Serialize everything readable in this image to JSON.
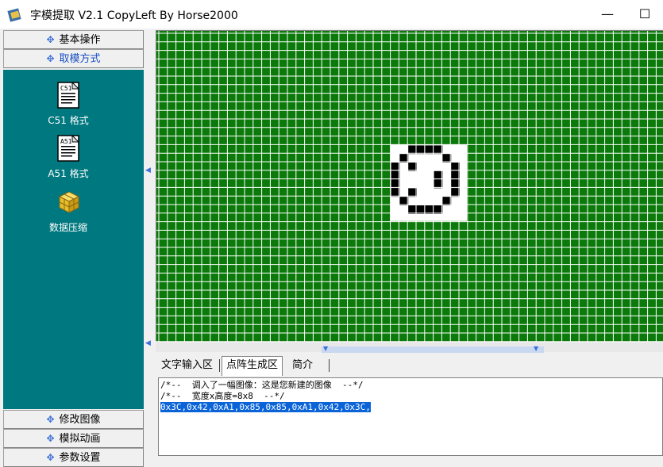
{
  "window": {
    "title": "字模提取 V2.1  CopyLeft By Horse2000",
    "minimize_glyph": "—",
    "maximize_glyph": "☐"
  },
  "sidebar": {
    "top_buttons": [
      {
        "label": "基本操作",
        "active": false
      },
      {
        "label": "取模方式",
        "active": true
      }
    ],
    "tools": [
      {
        "label": "C51 格式",
        "icon": "c51-doc-icon",
        "badge": "C51"
      },
      {
        "label": "A51 格式",
        "icon": "a51-doc-icon",
        "badge": "A51"
      },
      {
        "label": "数据压缩",
        "icon": "compress-icon"
      }
    ],
    "bottom_buttons": [
      {
        "label": "修改图像"
      },
      {
        "label": "模拟动画"
      },
      {
        "label": "参数设置"
      }
    ]
  },
  "canvas": {
    "background_color": "#0b7a0b",
    "grid_line_color": "#ffffff",
    "bitmap_size": "8x8",
    "bitmap_rows": [
      "00111100",
      "01000010",
      "10100001",
      "10000101",
      "10000101",
      "10100001",
      "01000010",
      "00111100"
    ]
  },
  "tabs": [
    {
      "label": "文字输入区",
      "active": false
    },
    {
      "label": "点阵生成区",
      "active": true
    },
    {
      "label": "简介",
      "active": false
    }
  ],
  "output": {
    "line1": "/*--  调入了一幅图像：这是您新建的图像  --*/",
    "line2": "/*--  宽度x高度=8x8  --*/",
    "line3": "0x3C,0x42,0xA1,0x85,0x85,0xA1,0x42,0x3C,"
  }
}
